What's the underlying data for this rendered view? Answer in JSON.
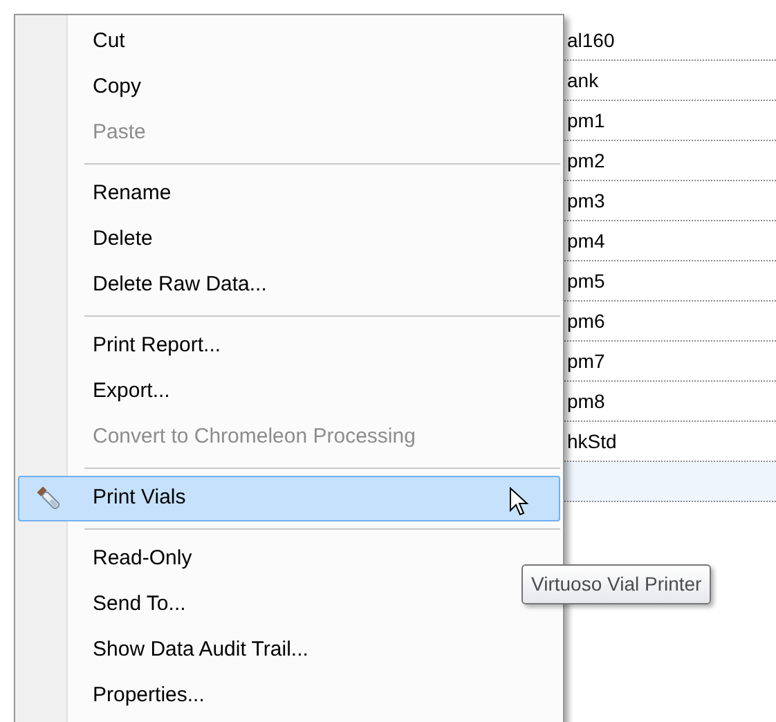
{
  "table": {
    "rows": [
      {
        "cell": "al160",
        "selected": false
      },
      {
        "cell": "ank",
        "selected": false
      },
      {
        "cell": "pm1",
        "selected": false
      },
      {
        "cell": "pm2",
        "selected": false
      },
      {
        "cell": "pm3",
        "selected": false
      },
      {
        "cell": "pm4",
        "selected": false
      },
      {
        "cell": "pm5",
        "selected": false
      },
      {
        "cell": "pm6",
        "selected": false
      },
      {
        "cell": "pm7",
        "selected": false
      },
      {
        "cell": "pm8",
        "selected": false
      },
      {
        "cell": "hkStd",
        "selected": false
      },
      {
        "cell": "",
        "selected": true
      }
    ]
  },
  "context_menu": {
    "items": [
      {
        "kind": "item",
        "label": "Cut",
        "disabled": false,
        "selected": false
      },
      {
        "kind": "item",
        "label": "Copy",
        "disabled": false,
        "selected": false
      },
      {
        "kind": "item",
        "label": "Paste",
        "disabled": true,
        "selected": false
      },
      {
        "kind": "separator"
      },
      {
        "kind": "item",
        "label": "Rename",
        "disabled": false,
        "selected": false
      },
      {
        "kind": "item",
        "label": "Delete",
        "disabled": false,
        "selected": false
      },
      {
        "kind": "item",
        "label": "Delete Raw Data...",
        "disabled": false,
        "selected": false
      },
      {
        "kind": "separator"
      },
      {
        "kind": "item",
        "label": "Print Report...",
        "disabled": false,
        "selected": false
      },
      {
        "kind": "item",
        "label": "Export...",
        "disabled": false,
        "selected": false
      },
      {
        "kind": "item",
        "label": "Convert to Chromeleon Processing",
        "disabled": true,
        "selected": false
      },
      {
        "kind": "separator"
      },
      {
        "kind": "icon-item",
        "label": "Print Vials",
        "disabled": false,
        "selected": true
      },
      {
        "kind": "separator"
      },
      {
        "kind": "item",
        "label": "Read-Only",
        "disabled": false,
        "selected": false
      },
      {
        "kind": "item",
        "label": "Send To...",
        "disabled": false,
        "selected": false
      },
      {
        "kind": "item",
        "label": "Show Data Audit Trail...",
        "disabled": false,
        "selected": false
      },
      {
        "kind": "item",
        "label": "Properties...",
        "disabled": false,
        "selected": false
      }
    ]
  },
  "tooltip": {
    "text": "Virtuoso Vial Printer"
  }
}
